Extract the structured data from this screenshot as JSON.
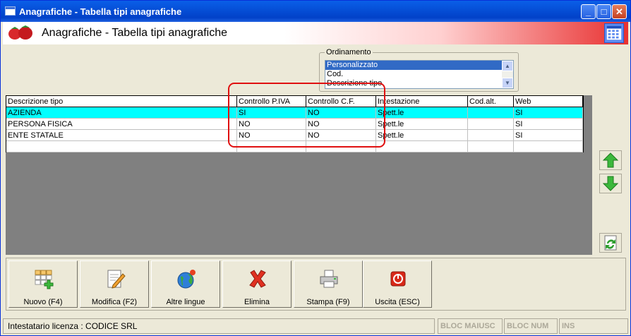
{
  "window": {
    "title": "Anagrafiche - Tabella tipi anagrafiche"
  },
  "header": {
    "title": "Anagrafiche - Tabella tipi anagrafiche"
  },
  "ordinamento": {
    "legend": "Ordinamento",
    "options": [
      "Personalizzato",
      "Cod.",
      "Descrizione tipo"
    ],
    "selected": "Personalizzato"
  },
  "table": {
    "columns": [
      "Descrizione tipo",
      "Controllo P.IVA",
      "Controllo C.F.",
      "Intestazione",
      "Cod.alt.",
      "Web"
    ],
    "rows": [
      [
        "AZIENDA",
        "SI",
        "NO",
        "Spett.le",
        "",
        "SI"
      ],
      [
        "PERSONA FISICA",
        "NO",
        "NO",
        "Spett.le",
        "",
        "SI"
      ],
      [
        "ENTE STATALE",
        "NO",
        "NO",
        "Spett.le",
        "",
        "SI"
      ]
    ],
    "selected_row": "AZIENDA"
  },
  "toolbar": {
    "nuovo": "Nuovo (F4)",
    "modifica": "Modifica (F2)",
    "lingue": "Altre lingue",
    "elimina": "Elimina",
    "stampa": "Stampa (F9)",
    "uscita": "Uscita (ESC)"
  },
  "status": {
    "license": "Intestatario licenza : CODICE SRL",
    "caps": "BLOC MAIUSC",
    "num": "BLOC NUM",
    "ins": "INS"
  },
  "colors": {
    "selection": "#00ffff",
    "highlight_box": "#e01010",
    "titlebar": "#0a5fe8"
  },
  "icons": [
    "strawberry-logo-icon",
    "calendar-icon",
    "arrow-up-icon",
    "arrow-down-icon",
    "refresh-icon",
    "new-grid-icon",
    "edit-icon",
    "globe-icon",
    "delete-x-icon",
    "printer-icon",
    "exit-icon"
  ]
}
